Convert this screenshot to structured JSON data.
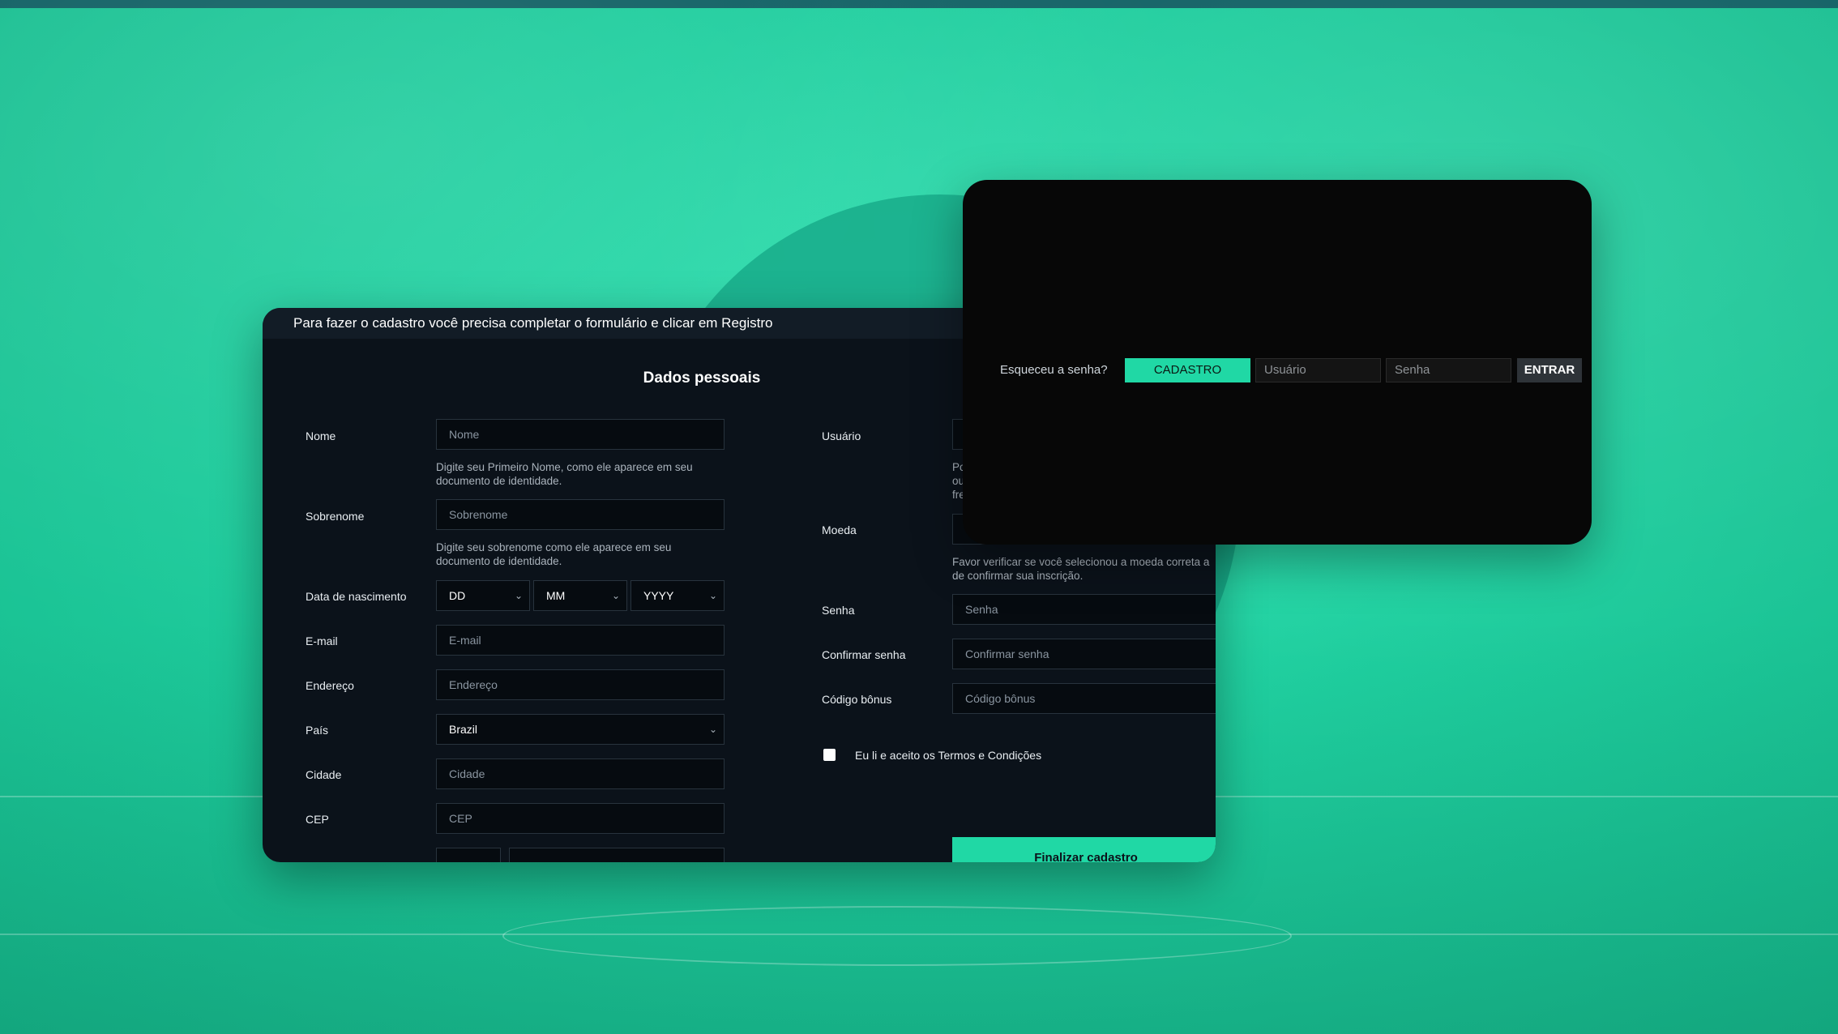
{
  "colors": {
    "accent": "#20d8a5",
    "card_bg": "#0b121a",
    "login_bg": "#070707"
  },
  "registration": {
    "header": "Para fazer o cadastro você precisa completar o formulário e clicar em Registro",
    "section_title": "Dados pessoais",
    "fields": {
      "nome": {
        "label": "Nome",
        "placeholder": "Nome",
        "hint": "Digite seu Primeiro Nome, como ele aparece em seu documento de identidade."
      },
      "sobrenome": {
        "label": "Sobrenome",
        "placeholder": "Sobrenome",
        "hint": "Digite seu sobrenome como ele aparece em seu documento de identidade."
      },
      "nascimento": {
        "label": "Data de nascimento",
        "day": "DD",
        "month": "MM",
        "year": "YYYY"
      },
      "email": {
        "label": "E-mail",
        "placeholder": "E-mail"
      },
      "endereco": {
        "label": "Endereço",
        "placeholder": "Endereço"
      },
      "pais": {
        "label": "País",
        "value": "Brazil"
      },
      "cidade": {
        "label": "Cidade",
        "placeholder": "Cidade"
      },
      "cep": {
        "label": "CEP",
        "placeholder": "CEP"
      },
      "usuario": {
        "label": "Usuário",
        "hint_fragment": "Po ou fre"
      },
      "moeda": {
        "label": "Moeda",
        "hint": "Favor verificar se você selecionou a moeda correta a de confirmar sua inscrição."
      },
      "senha": {
        "label": "Senha",
        "placeholder": "Senha"
      },
      "confirmar": {
        "label": "Confirmar senha",
        "placeholder": "Confirmar senha"
      },
      "bonus": {
        "label": "Código bônus",
        "placeholder": "Código bônus"
      }
    },
    "terms": "Eu li e aceito os Termos e Condições",
    "submit": "Finalizar cadastro"
  },
  "login": {
    "forgot": "Esqueceu a senha?",
    "register_button": "CADASTRO",
    "user_placeholder": "Usuário",
    "password_placeholder": "Senha",
    "enter_button": "ENTRAR"
  },
  "icons": {
    "dropdown": "chevron-down-icon",
    "checkbox": "checkbox-icon"
  }
}
